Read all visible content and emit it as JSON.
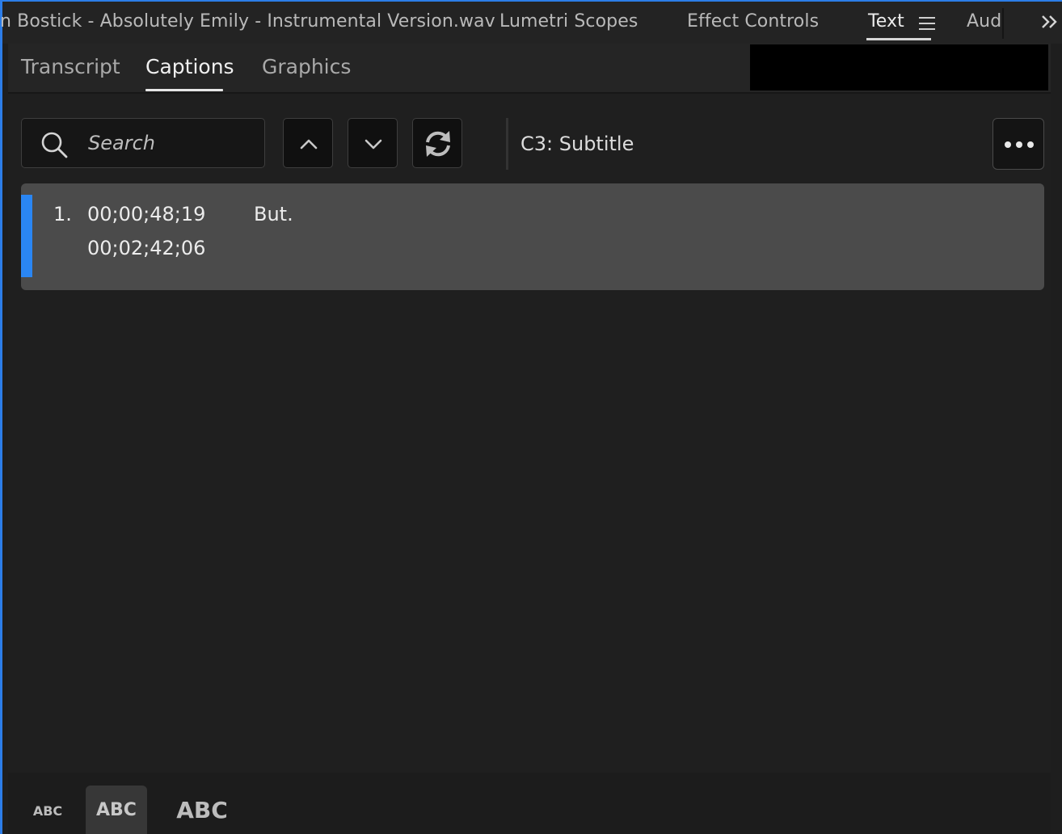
{
  "panel_tabs": {
    "items": [
      {
        "label": "n Bostick - Absolutely Emily - Instrumental Version.wav"
      },
      {
        "label": "Lumetri Scopes"
      },
      {
        "label": "Effect Controls"
      },
      {
        "label": "Text"
      },
      {
        "label": "Aud"
      }
    ],
    "active": "Text"
  },
  "sub_tabs": {
    "items": [
      {
        "label": "Transcript"
      },
      {
        "label": "Captions"
      },
      {
        "label": "Graphics"
      }
    ],
    "active": "Captions"
  },
  "toolbar": {
    "search_placeholder": "Search",
    "track_label": "C3: Subtitle"
  },
  "captions": [
    {
      "index": "1.",
      "start": "00;00;48;19",
      "end": "00;02;42;06",
      "text": "But."
    }
  ],
  "text_size": {
    "options": [
      {
        "label": "ABC"
      },
      {
        "label": "ABC"
      },
      {
        "label": "ABC"
      }
    ],
    "selected_index": 1
  },
  "colors": {
    "accent": "#2a86f3",
    "caption_row_bg": "#4b4b4b"
  }
}
